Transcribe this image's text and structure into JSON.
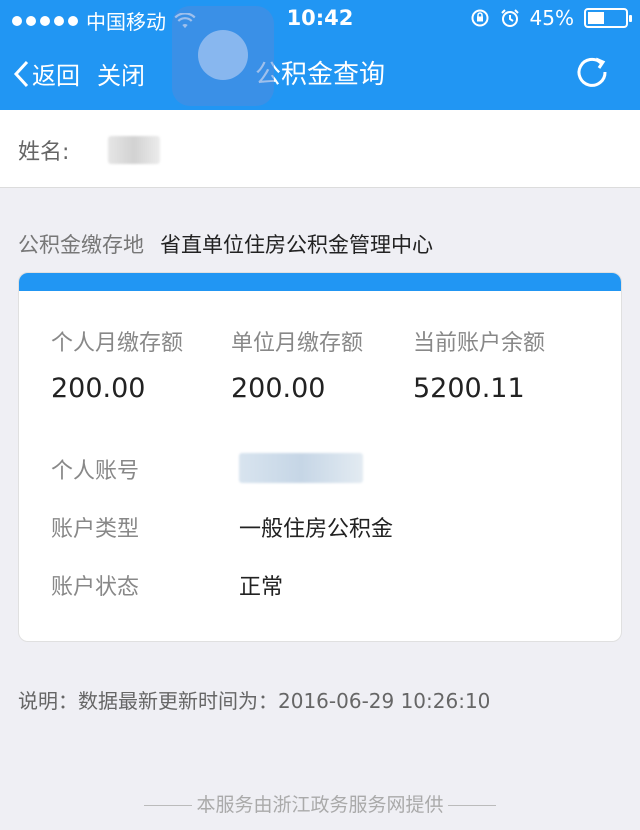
{
  "status_bar": {
    "carrier": "中国移动",
    "time": "10:42",
    "battery_text": "45%",
    "battery_level": 0.45
  },
  "nav": {
    "back_label": "返回",
    "close_label": "关闭",
    "title": "公积金查询"
  },
  "name": {
    "label": "姓名:"
  },
  "deposit_place": {
    "label": "公积金缴存地",
    "value": "省直单位住房公积金管理中心"
  },
  "summary": [
    {
      "label": "个人月缴存额",
      "value": "200.00"
    },
    {
      "label": "单位月缴存额",
      "value": "200.00"
    },
    {
      "label": "当前账户余额",
      "value": "5200.11"
    }
  ],
  "details": {
    "account_no_label": "个人账号",
    "account_type_label": "账户类型",
    "account_type_value": "一般住房公积金",
    "account_status_label": "账户状态",
    "account_status_value": "正常"
  },
  "note": "说明：数据最新更新时间为：2016-06-29 10:26:10",
  "footer": "本服务由浙江政务服务网提供",
  "colors": {
    "primary": "#2196f3",
    "background": "#efeff4"
  }
}
